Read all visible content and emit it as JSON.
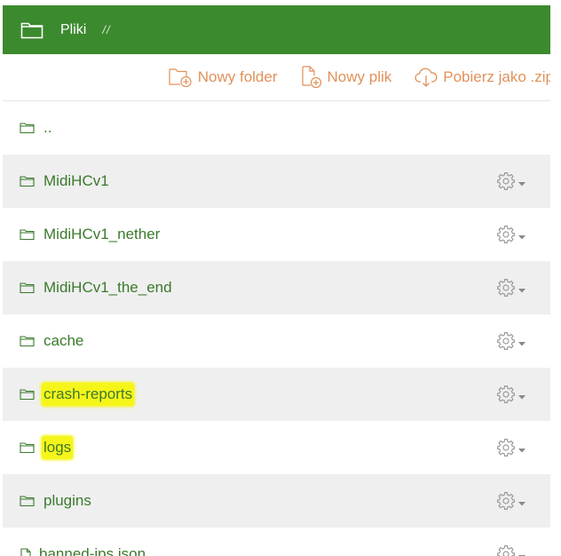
{
  "header": {
    "title": "Pliki",
    "separator": "//"
  },
  "toolbar": {
    "new_folder": "Nowy folder",
    "new_file": "Nowy plik",
    "download_zip": "Pobierz jako .zip"
  },
  "files": [
    {
      "name": "..",
      "type": "folder-up"
    },
    {
      "name": "MidiHCv1",
      "type": "folder"
    },
    {
      "name": "MidiHCv1_nether",
      "type": "folder"
    },
    {
      "name": "MidiHCv1_the_end",
      "type": "folder"
    },
    {
      "name": "cache",
      "type": "folder"
    },
    {
      "name": "crash-reports",
      "type": "folder",
      "highlighted": true
    },
    {
      "name": "logs",
      "type": "folder",
      "highlighted": true
    },
    {
      "name": "plugins",
      "type": "folder"
    },
    {
      "name": "banned-ips.json",
      "type": "file"
    }
  ],
  "colors": {
    "header_bg": "#3c8a2e",
    "link": "#3a7a2c",
    "toolbar_accent": "#e0915a",
    "highlight": "#f6f51a"
  },
  "icons": {
    "header": "folder-icon",
    "row_folder": "folder-icon",
    "row_file": "file-icon",
    "row_action": "gear-icon"
  }
}
